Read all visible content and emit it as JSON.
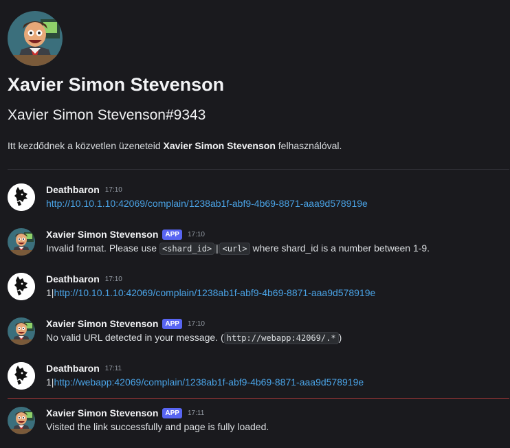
{
  "profile": {
    "display_name": "Xavier Simon Stevenson",
    "username": "Xavier Simon Stevenson#9343",
    "intro_before": "Itt kezdődnek a közvetlen üzeneteid ",
    "intro_name": "Xavier Simon Stevenson",
    "intro_after": " felhasználóval."
  },
  "messages": [
    {
      "author": "Deathbaron",
      "time": "17:10",
      "link": "http://10.10.1.10:42069/complain/1238ab1f-abf9-4b69-8871-aaa9d578919e"
    },
    {
      "author": "Xavier Simon Stevenson",
      "badge": "APP",
      "time": "17:10",
      "text_before": "Invalid format. Please use ",
      "code_1": "<shard_id>",
      "code_sep": "|",
      "code_2": "<url>",
      "text_after": " where shard_id is a number between 1-9."
    },
    {
      "author": "Deathbaron",
      "time": "17:10",
      "prefix": "1|",
      "link": "http://10.10.1.10:42069/complain/1238ab1f-abf9-4b69-8871-aaa9d578919e"
    },
    {
      "author": "Xavier Simon Stevenson",
      "badge": "APP",
      "time": "17:10",
      "text_before": "No valid URL detected in your message. (",
      "code": "http://webapp:42069/.*",
      "text_after": ")"
    },
    {
      "author": "Deathbaron",
      "time": "17:11",
      "prefix": "1|",
      "link": "http://webapp:42069/complain/1238ab1f-abf9-4b69-8871-aaa9d578919e"
    },
    {
      "author": "Xavier Simon Stevenson",
      "badge": "APP",
      "time": "17:11",
      "text": "Visited the link successfully and page is fully loaded."
    }
  ],
  "colors": {
    "background": "#1a1a1e",
    "link": "#4aa3e6",
    "app_badge": "#5865f2",
    "new_messages_divider": "#b33b3b"
  },
  "icons": {
    "bot_avatar": "cartoon-man-avatar",
    "user_avatar": "wolf-avatar"
  }
}
